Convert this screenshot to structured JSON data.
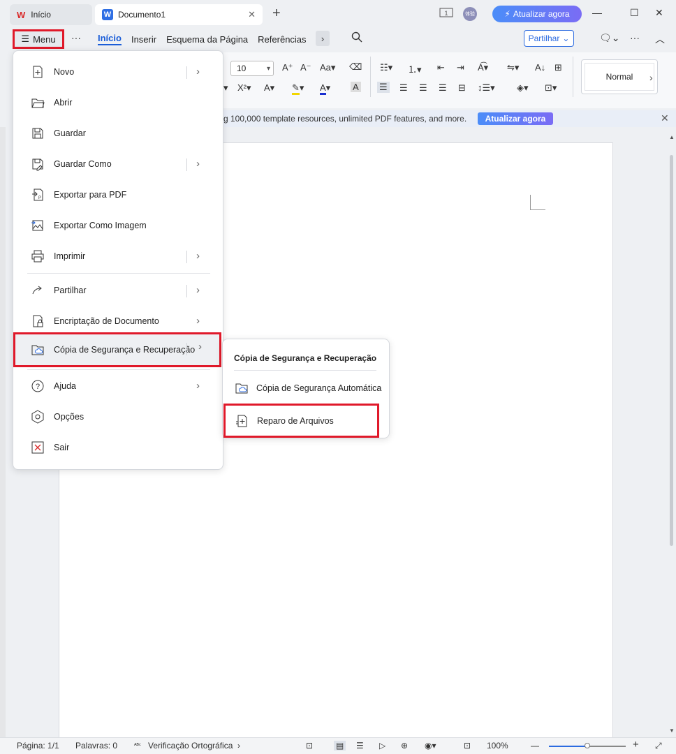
{
  "titlebar": {
    "home_tab": "Início",
    "doc_tab": "Documento1",
    "home_logo": "W",
    "doc_logo": "W",
    "upgrade": "Atualizar agora",
    "avatar_text": "体验"
  },
  "ribbon": {
    "menu_label": "Menu",
    "tabs": [
      "Início",
      "Inserir",
      "Esquema da Página",
      "Referências"
    ],
    "share": "Partilhar",
    "font_size": "10",
    "style_name": "Normal"
  },
  "banner": {
    "text": "g 100,000 template resources, unlimited PDF features, and more.",
    "button": "Atualizar agora"
  },
  "menu": {
    "items": [
      {
        "label": "Novo",
        "icon": "new-doc-icon"
      },
      {
        "label": "Abrir",
        "icon": "folder-open-icon"
      },
      {
        "label": "Guardar",
        "icon": "save-icon"
      },
      {
        "label": "Guardar Como",
        "icon": "save-as-icon"
      },
      {
        "label": "Exportar para PDF",
        "icon": "pdf-export-icon"
      },
      {
        "label": "Exportar Como Imagem",
        "icon": "image-export-icon"
      },
      {
        "label": "Imprimir",
        "icon": "printer-icon"
      },
      {
        "label": "Partilhar",
        "icon": "share-icon"
      },
      {
        "label": "Encriptação de Documento",
        "icon": "encrypt-doc-icon"
      },
      {
        "label": "Cópia de Segurança e Recuperação",
        "icon": "backup-folder-icon"
      },
      {
        "label": "Ajuda",
        "icon": "help-icon"
      },
      {
        "label": "Opções",
        "icon": "options-icon"
      },
      {
        "label": "Sair",
        "icon": "exit-icon"
      }
    ]
  },
  "submenu": {
    "title": "Cópia de Segurança e Recuperação",
    "items": [
      {
        "label": "Cópia de Segurança Automática",
        "icon": "auto-backup-icon"
      },
      {
        "label": "Reparo de Arquivos",
        "icon": "file-repair-icon"
      }
    ]
  },
  "status": {
    "page": "Página: 1/1",
    "words": "Palavras: 0",
    "spell": "Verificação Ortográfica",
    "zoom": "100%",
    "zoom_level": 0.5
  },
  "colors": {
    "highlight_red": "#e0192a",
    "accent_blue": "#2c6be0"
  }
}
